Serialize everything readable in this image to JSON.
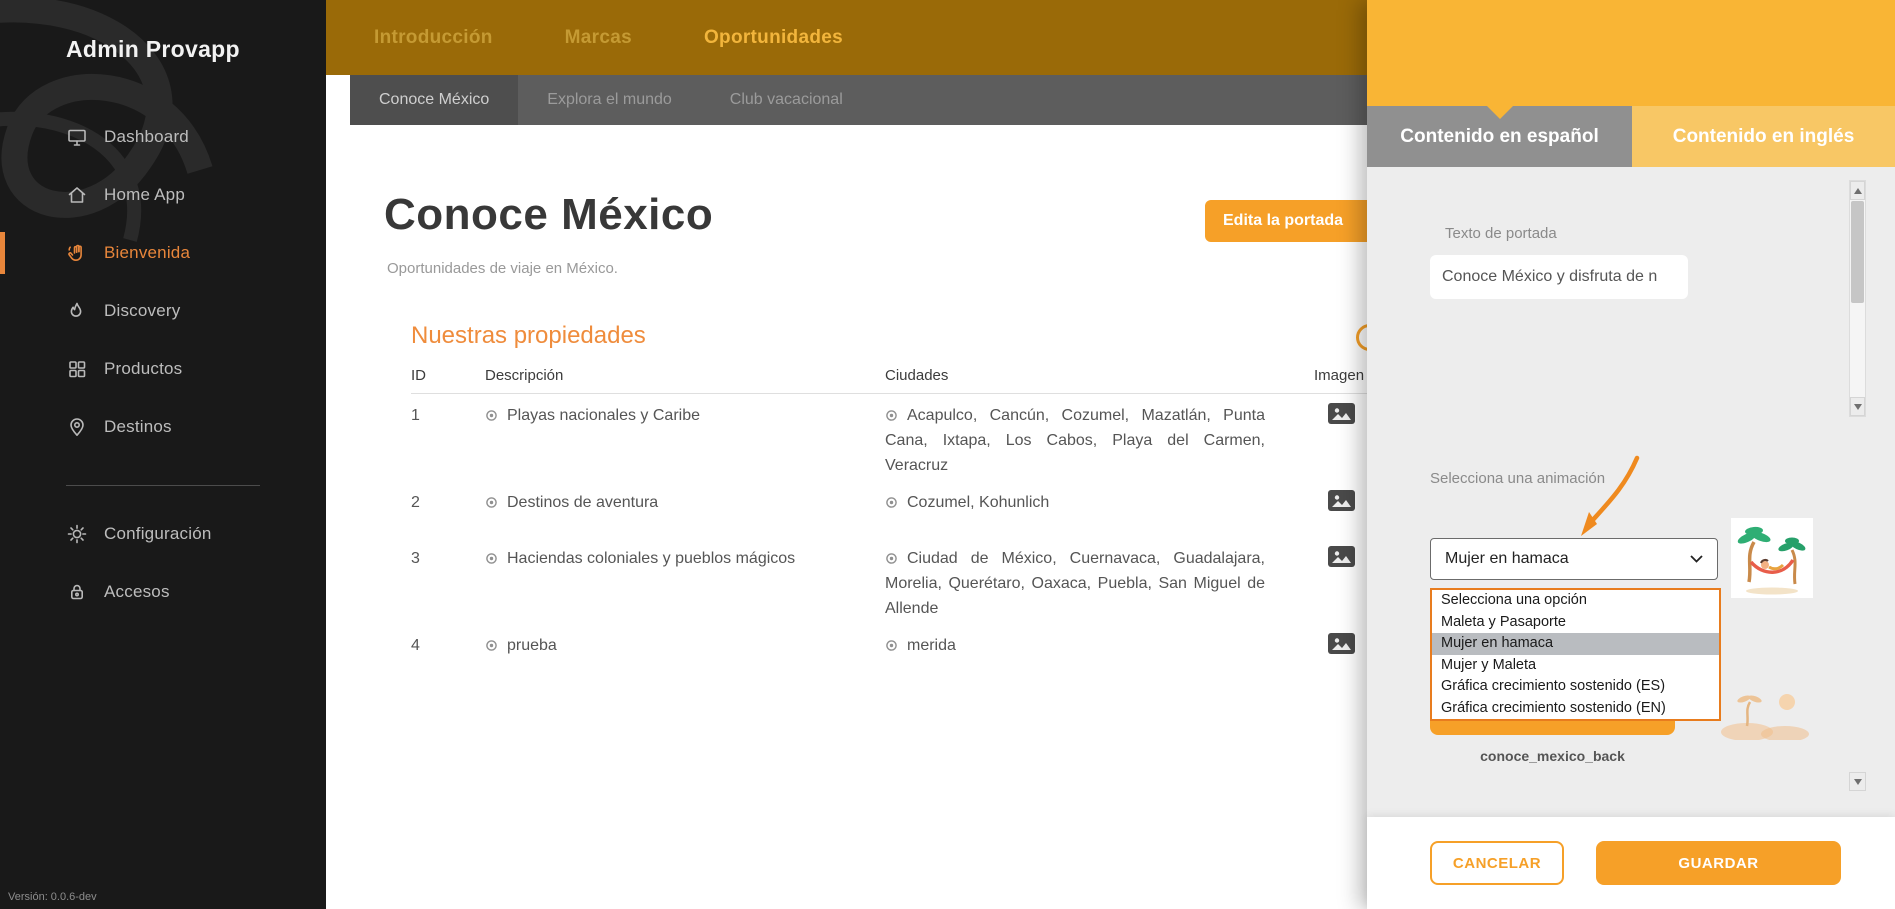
{
  "colors": {
    "accent": "#f6a028",
    "panel_header": "#f9b535",
    "topnav": "#9a6a08",
    "active_sidebar": "#e8863b"
  },
  "sidebar": {
    "title": "Admin Provapp",
    "items": [
      {
        "label": "Dashboard",
        "icon": "monitor-icon",
        "active": false
      },
      {
        "label": "Home App",
        "icon": "home-icon",
        "active": false
      },
      {
        "label": "Bienvenida",
        "icon": "wave-hand-icon",
        "active": true
      },
      {
        "label": "Discovery",
        "icon": "flame-icon",
        "active": false
      },
      {
        "label": "Productos",
        "icon": "grid-icon",
        "active": false
      },
      {
        "label": "Destinos",
        "icon": "location-pin-icon",
        "active": false
      },
      {
        "label": "Configuración",
        "icon": "gear-icon",
        "active": false
      },
      {
        "label": "Accesos",
        "icon": "lock-icon",
        "active": false
      }
    ],
    "version": "Versión: 0.0.6-dev"
  },
  "topnav": {
    "tabs": [
      {
        "label": "Introducción",
        "active": false
      },
      {
        "label": "Marcas",
        "active": false
      },
      {
        "label": "Oportunidades",
        "active": true
      }
    ]
  },
  "subnav": {
    "tabs": [
      {
        "label": "Conoce México",
        "active": true
      },
      {
        "label": "Explora el mundo",
        "active": false
      },
      {
        "label": "Club vacacional",
        "active": false
      }
    ]
  },
  "main": {
    "title": "Conoce México",
    "subtitle": "Oportunidades de viaje en México.",
    "edit_cover_button": "Edita la portada",
    "section_title": "Nuestras propiedades",
    "table": {
      "headers": [
        "ID",
        "Descripción",
        "Ciudades",
        "Imagen"
      ],
      "rows": [
        {
          "id": "1",
          "descripcion": "Playas nacionales y Caribe",
          "ciudades": "Acapulco, Cancún, Cozumel, Mazatlán, Punta Cana, Ixtapa, Los Cabos, Playa del Carmen, Veracruz"
        },
        {
          "id": "2",
          "descripcion": "Destinos de aventura",
          "ciudades": "Cozumel, Kohunlich"
        },
        {
          "id": "3",
          "descripcion": "Haciendas coloniales y pueblos mágicos",
          "ciudades": "Ciudad de México, Cuernavaca, Guadalajara, Morelia, Querétaro, Oaxaca, Puebla, San Miguel de Allende"
        },
        {
          "id": "4",
          "descripcion": "prueba",
          "ciudades": "merida"
        }
      ]
    }
  },
  "panel": {
    "tabs": [
      {
        "label": "Contenido en español",
        "active": true
      },
      {
        "label": "Contenido en inglés",
        "active": false
      }
    ],
    "cover_text_label": "Texto de portada",
    "cover_text_value": "Conoce México y disfruta de n",
    "animation_label": "Selecciona una animación",
    "animation_select_value": "Mujer en hamaca",
    "animation_options": [
      "Selecciona una opción",
      "Maleta y Pasaporte",
      "Mujer en hamaca",
      "Mujer y Maleta",
      "Gráfica crecimiento sostenido (ES)",
      "Gráfica crecimiento sostenido (EN)"
    ],
    "selected_option_index": 2,
    "image_name": "conoce_mexico_back",
    "cancel_button": "CANCELAR",
    "save_button": "GUARDAR"
  }
}
